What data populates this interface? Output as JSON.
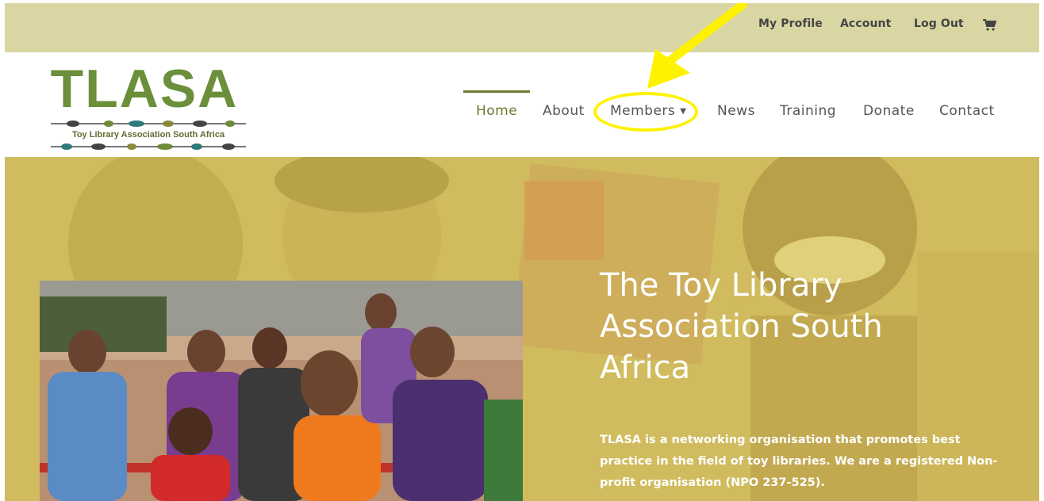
{
  "topbar": {
    "links": [
      "My Profile",
      "Account",
      "Log Out"
    ],
    "cart_icon": "cart-icon",
    "background": "#d9d6a3"
  },
  "logo": {
    "title": "TLASA",
    "subtitle": "Toy Library Association South Africa",
    "color": "#6b8f3a"
  },
  "nav": {
    "items": [
      "Home",
      "About",
      "Members",
      "News",
      "Training",
      "Donate",
      "Contact"
    ],
    "active": "Home",
    "members_has_dropdown": true,
    "highlighted": "Members",
    "active_color": "#6b7a2f"
  },
  "annotation": {
    "color": "#fff200",
    "target": "Members"
  },
  "hero": {
    "title": "The Toy Library Association South Africa",
    "description": "TLASA is a networking organisation that promotes best practice in the field of toy libraries. We are a registered Non-profit organisation (NPO 237-525).",
    "overlay_color": "#d6c45e"
  }
}
